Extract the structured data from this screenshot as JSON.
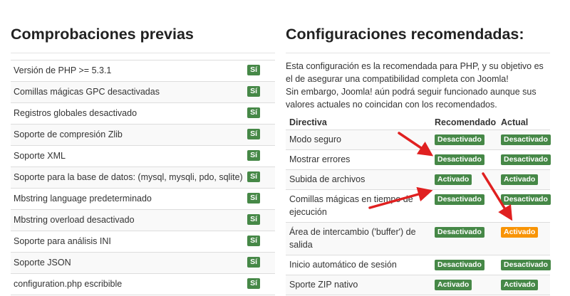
{
  "left": {
    "title": "Comprobaciones previas",
    "rows": [
      {
        "label": "Versión de PHP >= 5.3.1",
        "status": "Sí"
      },
      {
        "label": "Comillas mágicas GPC desactivadas",
        "status": "Sí"
      },
      {
        "label": "Registros globales desactivado",
        "status": "Sí"
      },
      {
        "label": "Soporte de compresión Zlib",
        "status": "Sí"
      },
      {
        "label": "Soporte XML",
        "status": "Sí"
      },
      {
        "label": "Soporte para la base de datos: (mysql, mysqli, pdo, sqlite)",
        "status": "Sí"
      },
      {
        "label": "Mbstring language predeterminado",
        "status": "Sí"
      },
      {
        "label": "Mbstring overload desactivado",
        "status": "Sí"
      },
      {
        "label": "Soporte para análisis INI",
        "status": "Sí"
      },
      {
        "label": "Soporte JSON",
        "status": "Sí"
      },
      {
        "label": "configuration.php escribible",
        "status": "Sí"
      }
    ]
  },
  "right": {
    "title": "Configuraciones recomendadas:",
    "intro_line1": "Esta configuración es la recomendada para PHP, y su objetivo es el de asegurar una compatibilidad completa con Joomla!",
    "intro_line2": "Sin embargo, Joomla! aún podrá seguir funcionado aunque sus valores actuales no coincidan con los recomendados.",
    "headers": {
      "directive": "Directiva",
      "recommended": "Recomendado",
      "actual": "Actual"
    },
    "rows": [
      {
        "directive": "Modo seguro",
        "recommended": "Desactivado",
        "actual": "Desactivado",
        "actual_color": "#468847"
      },
      {
        "directive": "Mostrar errores",
        "recommended": "Desactivado",
        "actual": "Desactivado",
        "actual_color": "#468847"
      },
      {
        "directive": "Subida de archivos",
        "recommended": "Activado",
        "actual": "Activado",
        "actual_color": "#468847"
      },
      {
        "directive": "Comillas mágicas en tiempo de ejecución",
        "recommended": "Desactivado",
        "actual": "Desactivado",
        "actual_color": "#468847"
      },
      {
        "directive": "Área de intercambio ('buffer') de salida",
        "recommended": "Desactivado",
        "actual": "Activado",
        "actual_color": "#f89406"
      },
      {
        "directive": "Inicio automático de sesión",
        "recommended": "Desactivado",
        "actual": "Desactivado",
        "actual_color": "#468847"
      },
      {
        "directive": "Sporte ZIP nativo",
        "recommended": "Activado",
        "actual": "Activado",
        "actual_color": "#468847"
      }
    ]
  },
  "colors": {
    "success": "#468847",
    "warning": "#f89406",
    "arrow": "#e02020"
  }
}
